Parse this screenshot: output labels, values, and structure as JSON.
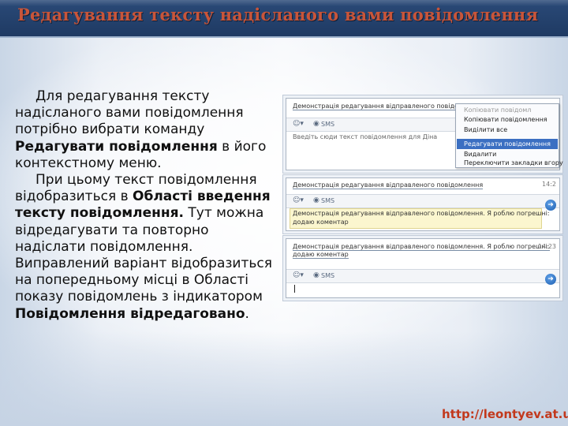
{
  "slide": {
    "title": "Редагування тексту надісланого вами повідомлення",
    "footer_link": "http://leontyev.at.ua",
    "colors": {
      "title_bar": "#1f3a63",
      "title_text": "#c8553a",
      "link": "#c2381c",
      "menu_highlight": "#3b6fc2"
    }
  },
  "body": {
    "p1_a": "Для редагування тексту надісланого вами повідомлення потрібно вибрати команду ",
    "p1_bold": "Редагувати повідомлення",
    "p1_b": " в його контекстному меню.",
    "p2_a": "При цьому текст повідомлення відобразиться в ",
    "p2_bold1": "Області введення тексту повідомлення.",
    "p2_b": " Тут можна відредагувати та повторно надіслати повідомлення. Виправлений варіант відобразиться на попередньому місці в Області показу повідомлень з індикатором ",
    "p2_bold2": "Повідомлення відредаговано",
    "p2_c": "."
  },
  "screenshot1": {
    "message": "Демонстрація редагування відправленого повідомлення",
    "toolbar_label": "SMS",
    "input_placeholder": "Введіть сюди текст повідомлення для Діна",
    "context_menu": [
      {
        "label": "Копіювати повідомл",
        "state": "dim"
      },
      {
        "label": "Копіювати повідомлення",
        "state": "normal"
      },
      {
        "label": "Виділити все",
        "state": "normal"
      },
      {
        "label": "Редагувати повідомлення",
        "state": "selected"
      },
      {
        "label": "Видалити",
        "state": "normal"
      },
      {
        "label": "Переключити закладки вгору",
        "state": "normal"
      }
    ]
  },
  "screenshot2": {
    "message": "Демонстрація редагування відправленого повідомлення",
    "time": "14:2",
    "toolbar_label": "SMS",
    "input_text_1": "Демонстрація редагування відправленого повідомлення. Я роблю погрешні:",
    "input_text_2": "додаю коментар"
  },
  "screenshot3": {
    "message_1": "Демонстрація редагування відправленого повідомлення. Я роблю погрешні:",
    "message_2": "додаю коментар",
    "time": "14:23",
    "toolbar_label": "SMS"
  }
}
